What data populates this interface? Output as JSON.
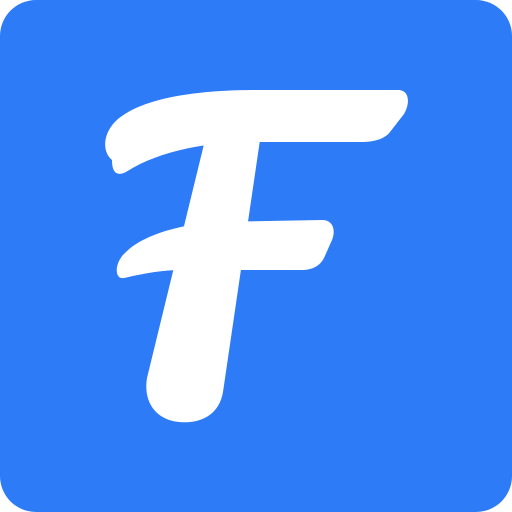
{
  "app_icon": {
    "glyph": "F",
    "background_color": "#2d7bf6",
    "glyph_color": "#ffffff",
    "icon_name": "letter-f-logo-icon"
  }
}
